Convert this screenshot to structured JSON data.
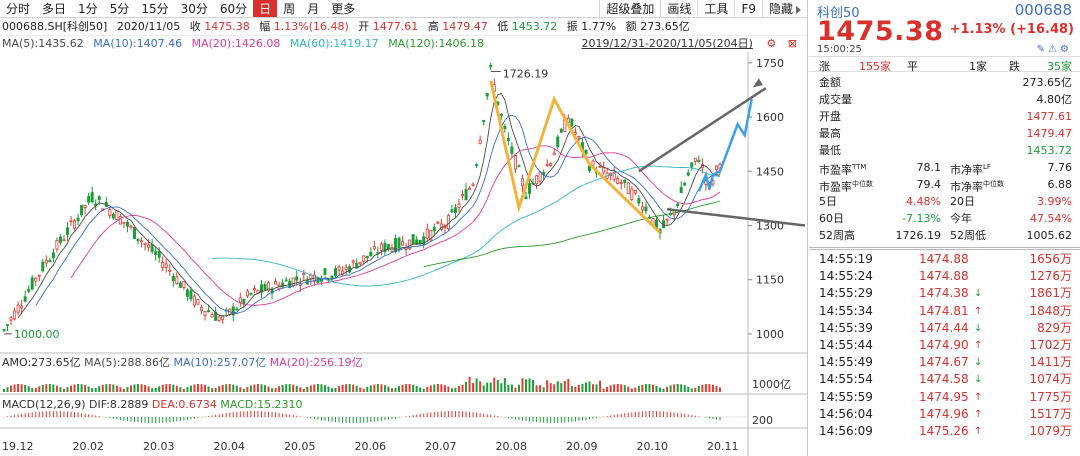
{
  "toolbar": {
    "periods": [
      "分时",
      "多日",
      "1分",
      "5分",
      "15分",
      "30分",
      "60分",
      "日",
      "周",
      "月",
      "更多"
    ],
    "active": "日",
    "tools": [
      "超级叠加",
      "画线",
      "工具",
      "F9",
      "隐藏"
    ]
  },
  "info_bar": {
    "symbol": "000688.SH[科创50]",
    "date": "2020/11/05",
    "close_label": "收",
    "close": "1475.38",
    "change_label": "幅",
    "change": "1.13%(16.48)",
    "open_label": "开",
    "open": "1477.61",
    "high_label": "高",
    "high": "1479.47",
    "low_label": "低",
    "low": "1453.72",
    "amp_label": "振",
    "amp": "1.77%",
    "amount_label": "额",
    "amount": "273.65亿"
  },
  "ma_legend": {
    "ma5": "MA(5):1435.62",
    "ma10": "MA(10):1407.46",
    "ma20": "MA(20):1426.08",
    "ma60": "MA(60):1419.17",
    "ma120": "MA(120):1406.18",
    "date_range": "2019/12/31-2020/11/05(204日)"
  },
  "volume_legend": {
    "amo": "AMO:273.65亿",
    "ma5": "MA(5):288.86亿",
    "ma10": "MA(10):257.07亿",
    "ma20": "MA(20):256.19亿",
    "axis_label": "1000亿"
  },
  "macd_legend": {
    "name": "MACD(12,26,9)",
    "dif": "DIF:8.2889",
    "dea": "DEA:0.6734",
    "macd": "MACD:15.2310",
    "axis_label": "200"
  },
  "chart_data": {
    "type": "candlestick",
    "price_axis_ticks": [
      1750,
      1600,
      1450,
      1300,
      1150,
      1000
    ],
    "ylim": [
      950,
      1780
    ],
    "x_labels": [
      "19.12",
      "20.02",
      "20.03",
      "20.04",
      "20.05",
      "20.06",
      "20.07",
      "20.08",
      "20.09",
      "20.10",
      "20.11"
    ],
    "annotations": {
      "high_label": "1726.19",
      "low_label": "1000.00"
    },
    "colors": {
      "up": "#e03c31",
      "down": "#1a9e3a",
      "ma5": "#4a4a4a",
      "ma10": "#3b6fc9",
      "ma20": "#e03c9b",
      "ma60": "#2fb8c9",
      "ma120": "#2a9a2a",
      "pattern": "#f0b43c",
      "projection": "#3aa0e8",
      "trend": "#666666"
    }
  },
  "quote": {
    "name": "科创50",
    "code": "000688",
    "price": "1475.38",
    "change": "+1.13% (+16.48)",
    "time": "15:00:25",
    "icons": [
      "edit-icon",
      "alert-icon",
      "settings-icon"
    ],
    "breadth": {
      "up_label": "涨",
      "up": "155家",
      "flat_label": "平",
      "flat": "1家",
      "down_label": "跌",
      "down": "35家"
    },
    "stats": [
      {
        "k": "金额",
        "v": "273.65亿",
        "c": "black"
      },
      {
        "k": "成交量",
        "v": "4.80亿",
        "c": "black"
      },
      {
        "k": "开盘",
        "v": "1477.61",
        "c": "red"
      },
      {
        "k": "最高",
        "v": "1479.47",
        "c": "red"
      },
      {
        "k": "最低",
        "v": "1453.72",
        "c": "green"
      }
    ],
    "pairs": [
      {
        "k1": "市盈率",
        "s1": "TTM",
        "v1": "78.1",
        "k2": "市净率",
        "s2": "LF",
        "v2": "7.76",
        "c1": "black",
        "c2": "black"
      },
      {
        "k1": "市盈率",
        "s1": "中位数",
        "v1": "79.4",
        "k2": "市净率",
        "s2": "中位数",
        "v2": "6.88",
        "c1": "black",
        "c2": "black"
      },
      {
        "k1": "5日",
        "s1": "",
        "v1": "4.48%",
        "k2": "20日",
        "s2": "",
        "v2": "3.99%",
        "c1": "red",
        "c2": "red"
      },
      {
        "k1": "60日",
        "s1": "",
        "v1": "-7.13%",
        "k2": "今年",
        "s2": "",
        "v2": "47.54%",
        "c1": "green",
        "c2": "red"
      },
      {
        "k1": "52周高",
        "s1": "",
        "v1": "1726.19",
        "k2": "52周低",
        "s2": "",
        "v2": "1005.62",
        "c1": "black",
        "c2": "black"
      }
    ]
  },
  "ticks": [
    {
      "t": "14:55:19",
      "p": "1474.88",
      "d": "",
      "v": "1656万"
    },
    {
      "t": "14:55:24",
      "p": "1474.88",
      "d": "",
      "v": "1276万"
    },
    {
      "t": "14:55:29",
      "p": "1474.38",
      "d": "dn",
      "v": "1861万"
    },
    {
      "t": "14:55:34",
      "p": "1474.81",
      "d": "up",
      "v": "1848万"
    },
    {
      "t": "14:55:39",
      "p": "1474.44",
      "d": "dn",
      "v": "829万"
    },
    {
      "t": "14:55:44",
      "p": "1474.90",
      "d": "up",
      "v": "1702万"
    },
    {
      "t": "14:55:49",
      "p": "1474.67",
      "d": "dn",
      "v": "1411万"
    },
    {
      "t": "14:55:54",
      "p": "1474.58",
      "d": "dn",
      "v": "1074万"
    },
    {
      "t": "14:55:59",
      "p": "1474.95",
      "d": "up",
      "v": "1775万"
    },
    {
      "t": "14:56:04",
      "p": "1474.96",
      "d": "up",
      "v": "1517万"
    },
    {
      "t": "14:56:09",
      "p": "1475.26",
      "d": "up",
      "v": "1079万"
    }
  ]
}
